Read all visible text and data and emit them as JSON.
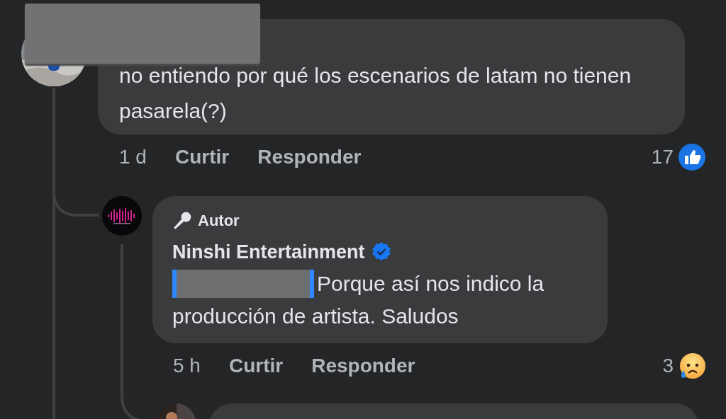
{
  "comments": [
    {
      "author_redacted": true,
      "text": "no entiendo por qué los escenarios de latam no tienen pasarela(?)",
      "time": "1 d",
      "actions": [
        "Curtir",
        "Responder"
      ],
      "reaction_count": "17",
      "reaction": {
        "kind": "like"
      }
    }
  ],
  "reply": {
    "avatar": {
      "kind": "logo"
    },
    "badge": "Autor",
    "author": "Ninshi Entertainment",
    "verified": true,
    "mention_redacted": true,
    "text": "Porque así nos indico la producción de artista. Saludos",
    "time": "5 h",
    "actions": [
      "Curtir",
      "Responder"
    ],
    "reaction_count": "3",
    "reaction": {
      "kind": "sad"
    }
  }
}
